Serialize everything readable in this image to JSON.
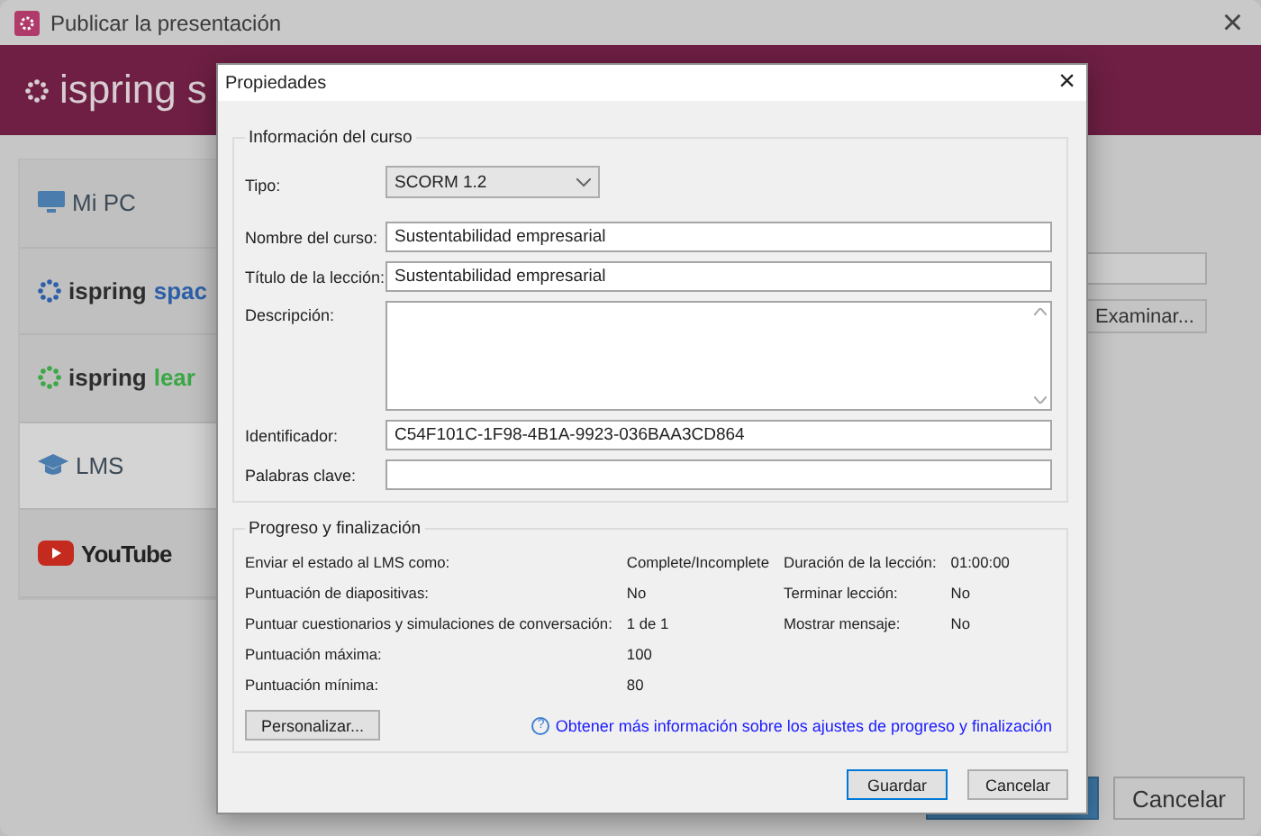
{
  "window": {
    "title": "Publicar la presentación",
    "close": "×"
  },
  "header": {
    "brand": "ispring s"
  },
  "sidebar": {
    "items": [
      {
        "kind": "pc",
        "label": "Mi PC",
        "selected": false
      },
      {
        "kind": "brand",
        "label": "ispring",
        "suffix": "spac",
        "color": "#2d5fa8",
        "selected": false
      },
      {
        "kind": "brand",
        "label": "ispring",
        "suffix": "lear",
        "color": "#3aa845",
        "selected": false
      },
      {
        "kind": "lms",
        "label": "LMS",
        "selected": true
      },
      {
        "kind": "youtube",
        "label": "YouTube",
        "selected": false
      }
    ]
  },
  "content": {
    "browse_button": "Examinar..."
  },
  "footer": {
    "cancel_button": "Cancelar"
  },
  "dialog": {
    "title": "Propiedades",
    "close": "×",
    "course_info": {
      "legend": "Información del curso",
      "type": {
        "label": "Tipo:",
        "value": "SCORM 1.2"
      },
      "fields": [
        {
          "kind": "input",
          "label": "Nombre del curso:",
          "value": "Sustentabilidad empresarial"
        },
        {
          "kind": "input",
          "label": "Título de la lección:",
          "value": "Sustentabilidad empresarial"
        },
        {
          "kind": "textarea",
          "label": "Descripción:"
        },
        {
          "kind": "input",
          "label": "Identificador:",
          "value": "C54F101C-1F98-4B1A-9923-036BAA3CD864"
        },
        {
          "kind": "input",
          "label": "Palabras clave:"
        }
      ]
    },
    "progress": {
      "legend": "Progreso y finalización",
      "rows": [
        {
          "label": "Enviar el estado al LMS como:",
          "value": "Complete/Incomplete",
          "label2": "Duración de la lección:",
          "value2": "01:00:00"
        },
        {
          "label": "Puntuación de diapositivas:",
          "value": "No",
          "label2": "Terminar lección:",
          "value2": "No"
        },
        {
          "label": "Puntuar cuestionarios y simulaciones de conversación:",
          "value": "1 de 1",
          "label2": "Mostrar mensaje:",
          "value2": "No"
        },
        {
          "label": "Puntuación máxima:",
          "value": "100"
        },
        {
          "label": "Puntuación mínima:",
          "value": "80"
        }
      ],
      "customize_button": "Personalizar...",
      "help_icon": "?",
      "help_link": "Obtener más información sobre los ajustes de progreso y finalización"
    },
    "buttons": [
      {
        "label": "Guardar",
        "default": true
      },
      {
        "label": "Cancelar",
        "default": false
      }
    ]
  }
}
